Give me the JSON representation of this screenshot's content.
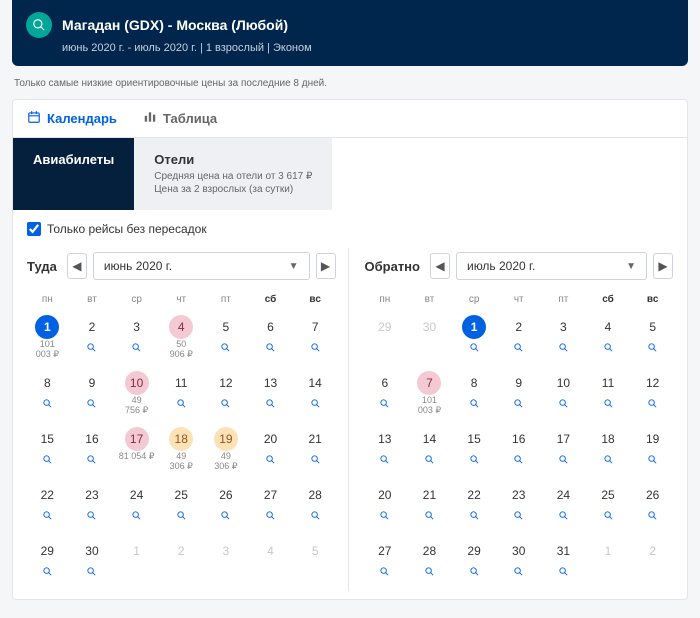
{
  "search": {
    "route": "Магадан (GDX) - Москва (Любой)",
    "sub": "июнь 2020 г. - июль 2020 г. | 1 взрослый | Эконом"
  },
  "note": "Только самые низкие ориентировочные цены за последние 8 дней.",
  "view_tabs": {
    "calendar": "Календарь",
    "table": "Таблица"
  },
  "prod_tabs": {
    "flights": "Авиабилеты",
    "hotels_title": "Отели",
    "hotels_l1": "Средняя цена на отели от 3 617 ₽",
    "hotels_l2": "Цена за 2 взрослых (за сутки)"
  },
  "filter": {
    "label": "Только рейсы без пересадок"
  },
  "dow": [
    "пн",
    "вт",
    "ср",
    "чт",
    "пт",
    "сб",
    "вс"
  ],
  "outbound": {
    "label": "Туда",
    "month": "июнь 2020 г.",
    "days": [
      {
        "n": "1",
        "sel": true,
        "p1": "101",
        "p2": "003 ₽"
      },
      {
        "n": "2",
        "mag": true
      },
      {
        "n": "3",
        "mag": true
      },
      {
        "n": "4",
        "pink": true,
        "p1": "50",
        "p2": "906 ₽"
      },
      {
        "n": "5",
        "mag": true
      },
      {
        "n": "6",
        "mag": true
      },
      {
        "n": "7",
        "mag": true
      },
      {
        "n": "8",
        "mag": true
      },
      {
        "n": "9",
        "mag": true
      },
      {
        "n": "10",
        "pink": true,
        "p1": "49",
        "p2": "756 ₽"
      },
      {
        "n": "11",
        "mag": true
      },
      {
        "n": "12",
        "mag": true
      },
      {
        "n": "13",
        "mag": true
      },
      {
        "n": "14",
        "mag": true
      },
      {
        "n": "15",
        "mag": true
      },
      {
        "n": "16",
        "mag": true
      },
      {
        "n": "17",
        "pink": true,
        "p1": "81 054 ₽"
      },
      {
        "n": "18",
        "orange": true,
        "p1": "49",
        "p2": "306 ₽"
      },
      {
        "n": "19",
        "orange": true,
        "p1": "49",
        "p2": "306 ₽"
      },
      {
        "n": "20",
        "mag": true
      },
      {
        "n": "21",
        "mag": true
      },
      {
        "n": "22",
        "mag": true
      },
      {
        "n": "23",
        "mag": true
      },
      {
        "n": "24",
        "mag": true
      },
      {
        "n": "25",
        "mag": true
      },
      {
        "n": "26",
        "mag": true
      },
      {
        "n": "27",
        "mag": true
      },
      {
        "n": "28",
        "mag": true
      },
      {
        "n": "29",
        "mag": true
      },
      {
        "n": "30",
        "mag": true
      },
      {
        "n": "1",
        "grey": true
      },
      {
        "n": "2",
        "grey": true
      },
      {
        "n": "3",
        "grey": true
      },
      {
        "n": "4",
        "grey": true
      },
      {
        "n": "5",
        "grey": true
      }
    ]
  },
  "inbound": {
    "label": "Обратно",
    "month": "июль 2020 г.",
    "days": [
      {
        "n": "29",
        "grey": true
      },
      {
        "n": "30",
        "grey": true
      },
      {
        "n": "1",
        "sel": true
      },
      {
        "n": "2",
        "mag": true
      },
      {
        "n": "3",
        "mag": true
      },
      {
        "n": "4",
        "mag": true
      },
      {
        "n": "5",
        "mag": true
      },
      {
        "n": "6",
        "mag": true
      },
      {
        "n": "7",
        "pink": true,
        "p1": "101",
        "p2": "003 ₽"
      },
      {
        "n": "8",
        "mag": true
      },
      {
        "n": "9",
        "mag": true
      },
      {
        "n": "10",
        "mag": true
      },
      {
        "n": "11",
        "mag": true
      },
      {
        "n": "12",
        "mag": true
      },
      {
        "n": "13",
        "mag": true
      },
      {
        "n": "14",
        "mag": true
      },
      {
        "n": "15",
        "mag": true
      },
      {
        "n": "16",
        "mag": true
      },
      {
        "n": "17",
        "mag": true
      },
      {
        "n": "18",
        "mag": true
      },
      {
        "n": "19",
        "mag": true
      },
      {
        "n": "20",
        "mag": true
      },
      {
        "n": "21",
        "mag": true
      },
      {
        "n": "22",
        "mag": true
      },
      {
        "n": "23",
        "mag": true
      },
      {
        "n": "24",
        "mag": true
      },
      {
        "n": "25",
        "mag": true
      },
      {
        "n": "26",
        "mag": true
      },
      {
        "n": "27",
        "mag": true
      },
      {
        "n": "28",
        "mag": true
      },
      {
        "n": "29",
        "mag": true
      },
      {
        "n": "30",
        "mag": true
      },
      {
        "n": "31",
        "mag": true
      },
      {
        "n": "1",
        "grey": true
      },
      {
        "n": "2",
        "grey": true
      }
    ]
  }
}
